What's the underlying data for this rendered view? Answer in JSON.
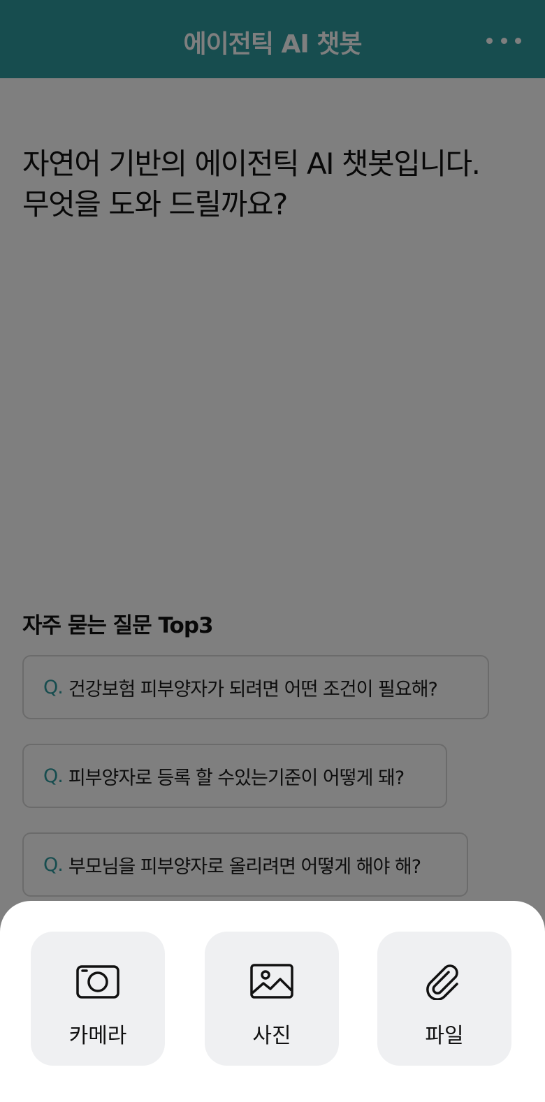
{
  "header": {
    "title": "에이전틱 AI 챗봇",
    "more_icon": "more-horizontal-icon",
    "background": "#2f9a9f"
  },
  "greeting": {
    "line1": "자연어 기반의 에이전틱 AI 챗봇입니다.",
    "line2": "무엇을 도와 드릴까요?"
  },
  "faq": {
    "title": "자주 묻는 질문 Top3",
    "prefix": "Q.",
    "items": [
      {
        "text": "건강보험 피부양자가 되려면 어떤 조건이 필요해?"
      },
      {
        "text": "피부양자로 등록 할 수있는기준이 어떻게 돼?"
      },
      {
        "text": "부모님을 피부양자로 올리려면 어떻게 해야 해?"
      }
    ]
  },
  "attachment_sheet": {
    "actions": [
      {
        "label": "카메라",
        "icon": "camera-icon"
      },
      {
        "label": "사진",
        "icon": "image-icon"
      },
      {
        "label": "파일",
        "icon": "paperclip-icon"
      }
    ]
  },
  "colors": {
    "accent": "#2f9a9f",
    "overlay": "rgba(0,0,0,0.5)",
    "action_bg": "#eff0f2"
  }
}
